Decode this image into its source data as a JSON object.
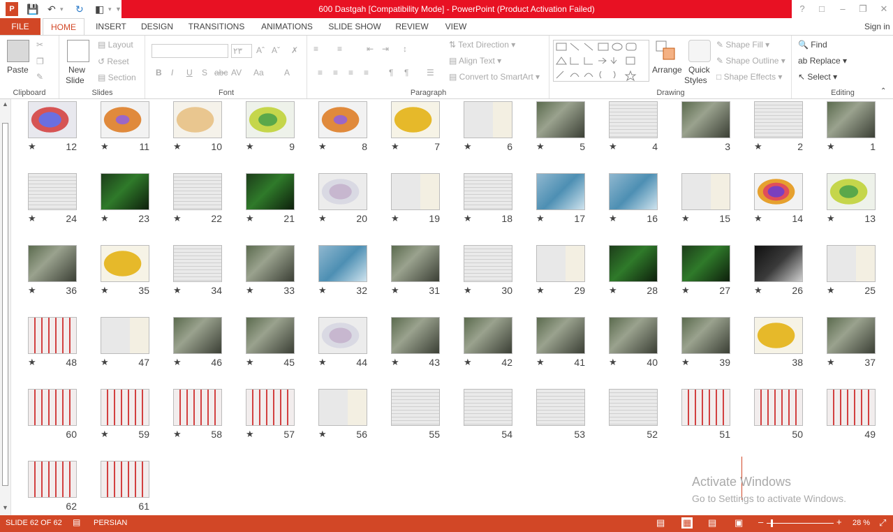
{
  "window": {
    "title": "600 Dastgah [Compatibility Mode] -  PowerPoint (Product Activation Failed)",
    "signin": "Sign in"
  },
  "tabs": [
    "FILE",
    "HOME",
    "INSERT",
    "DESIGN",
    "TRANSITIONS",
    "ANIMATIONS",
    "SLIDE SHOW",
    "REVIEW",
    "VIEW"
  ],
  "ribbon": {
    "clipboard": {
      "label": "Clipboard",
      "paste": "Paste"
    },
    "slides": {
      "label": "Slides",
      "new_slide_1": "New",
      "new_slide_2": "Slide",
      "layout": "Layout",
      "reset": "Reset",
      "section": "Section"
    },
    "font": {
      "label": "Font",
      "size": "۲۳"
    },
    "paragraph": {
      "label": "Paragraph",
      "text_direction": "Text Direction",
      "align_text": "Align Text",
      "smartart": "Convert to SmartArt"
    },
    "drawing": {
      "label": "Drawing",
      "arrange": "Arrange",
      "quick_1": "Quick",
      "quick_2": "Styles",
      "shape_fill": "Shape Fill",
      "shape_outline": "Shape Outline",
      "shape_effects": "Shape Effects"
    },
    "editing": {
      "label": "Editing",
      "find": "Find",
      "replace": "Replace",
      "select": "Select"
    }
  },
  "slides": [
    {
      "n": "12",
      "star": true,
      "t": "map-blue"
    },
    {
      "n": "11",
      "star": true,
      "t": "map-orange"
    },
    {
      "n": "10",
      "star": true,
      "t": "map-beige"
    },
    {
      "n": "9",
      "star": true,
      "t": "map-green"
    },
    {
      "n": "8",
      "star": true,
      "t": "map-orange"
    },
    {
      "n": "7",
      "star": true,
      "t": "map-yellow"
    },
    {
      "n": "6",
      "star": true,
      "t": "layout"
    },
    {
      "n": "5",
      "star": true,
      "t": "photo"
    },
    {
      "n": "4",
      "star": true,
      "t": "text"
    },
    {
      "n": "3",
      "star": false,
      "t": "photo"
    },
    {
      "n": "2",
      "star": true,
      "t": "text"
    },
    {
      "n": "1",
      "star": true,
      "t": "photo"
    },
    {
      "n": "24",
      "star": true,
      "t": "text"
    },
    {
      "n": "23",
      "star": true,
      "t": "green"
    },
    {
      "n": "22",
      "star": true,
      "t": "text"
    },
    {
      "n": "21",
      "star": true,
      "t": "green"
    },
    {
      "n": "20",
      "star": true,
      "t": "map-grey"
    },
    {
      "n": "19",
      "star": true,
      "t": "layout"
    },
    {
      "n": "18",
      "star": true,
      "t": "text"
    },
    {
      "n": "17",
      "star": true,
      "t": "blue"
    },
    {
      "n": "16",
      "star": true,
      "t": "blue"
    },
    {
      "n": "15",
      "star": true,
      "t": "layout"
    },
    {
      "n": "14",
      "star": true,
      "t": "map-purple"
    },
    {
      "n": "13",
      "star": true,
      "t": "map-green"
    },
    {
      "n": "36",
      "star": true,
      "t": "photo"
    },
    {
      "n": "35",
      "star": true,
      "t": "map-yellow"
    },
    {
      "n": "34",
      "star": true,
      "t": "text"
    },
    {
      "n": "33",
      "star": true,
      "t": "photo"
    },
    {
      "n": "32",
      "star": true,
      "t": "blue"
    },
    {
      "n": "31",
      "star": true,
      "t": "photo"
    },
    {
      "n": "30",
      "star": true,
      "t": "text"
    },
    {
      "n": "29",
      "star": true,
      "t": "layout"
    },
    {
      "n": "28",
      "star": true,
      "t": "green"
    },
    {
      "n": "27",
      "star": true,
      "t": "green"
    },
    {
      "n": "26",
      "star": true,
      "t": "dark"
    },
    {
      "n": "25",
      "star": true,
      "t": "layout"
    },
    {
      "n": "48",
      "star": true,
      "t": "red"
    },
    {
      "n": "47",
      "star": true,
      "t": "layout"
    },
    {
      "n": "46",
      "star": true,
      "t": "photo"
    },
    {
      "n": "45",
      "star": true,
      "t": "photo"
    },
    {
      "n": "44",
      "star": true,
      "t": "map-grey"
    },
    {
      "n": "43",
      "star": true,
      "t": "photo"
    },
    {
      "n": "42",
      "star": true,
      "t": "photo"
    },
    {
      "n": "41",
      "star": true,
      "t": "photo"
    },
    {
      "n": "40",
      "star": true,
      "t": "photo"
    },
    {
      "n": "39",
      "star": true,
      "t": "photo"
    },
    {
      "n": "38",
      "star": false,
      "t": "map-yellow"
    },
    {
      "n": "37",
      "star": true,
      "t": "photo"
    },
    {
      "n": "60",
      "star": false,
      "t": "red"
    },
    {
      "n": "59",
      "star": true,
      "t": "red"
    },
    {
      "n": "58",
      "star": true,
      "t": "red"
    },
    {
      "n": "57",
      "star": true,
      "t": "red"
    },
    {
      "n": "56",
      "star": true,
      "t": "layout"
    },
    {
      "n": "55",
      "star": false,
      "t": "text"
    },
    {
      "n": "54",
      "star": false,
      "t": "text"
    },
    {
      "n": "53",
      "star": false,
      "t": "text"
    },
    {
      "n": "52",
      "star": false,
      "t": "text"
    },
    {
      "n": "51",
      "star": false,
      "t": "red"
    },
    {
      "n": "50",
      "star": false,
      "t": "red"
    },
    {
      "n": "49",
      "star": false,
      "t": "red"
    },
    {
      "n": "62",
      "star": false,
      "t": "red"
    },
    {
      "n": "61",
      "star": false,
      "t": "red"
    }
  ],
  "watermark": {
    "line1": "Activate Windows",
    "line2": "Go to Settings to activate Windows."
  },
  "status": {
    "slide": "SLIDE 62 OF 62",
    "language": "PERSIAN",
    "zoom": "28 %"
  }
}
